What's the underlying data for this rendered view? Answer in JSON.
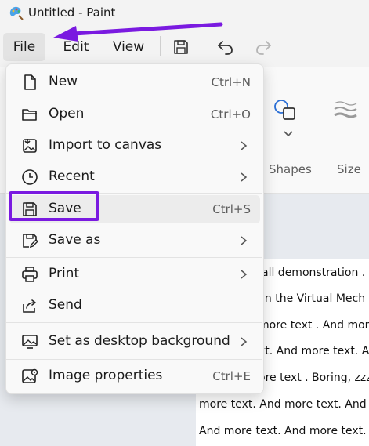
{
  "window": {
    "title": "Untitled - Paint"
  },
  "menubar": {
    "file": "File",
    "edit": "Edit",
    "view": "View"
  },
  "ribbon": {
    "shapes_label": "Shapes",
    "size_label": "Size"
  },
  "file_menu": {
    "items": [
      {
        "label": "New",
        "shortcut": "Ctrl+N",
        "icon": "new-file-icon"
      },
      {
        "label": "Open",
        "shortcut": "Ctrl+O",
        "icon": "folder-icon"
      },
      {
        "label": "Import to canvas",
        "shortcut": "",
        "icon": "import-image-icon",
        "submenu": true
      },
      {
        "label": "Recent",
        "shortcut": "",
        "icon": "clock-icon",
        "submenu": true
      },
      {
        "label": "Save",
        "shortcut": "Ctrl+S",
        "icon": "save-icon"
      },
      {
        "label": "Save as",
        "shortcut": "",
        "icon": "save-as-icon",
        "submenu": true
      },
      {
        "label": "Print",
        "shortcut": "",
        "icon": "printer-icon",
        "submenu": true
      },
      {
        "label": "Send",
        "shortcut": "",
        "icon": "share-icon"
      },
      {
        "label": "Set as desktop background",
        "shortcut": "",
        "icon": "desktop-background-icon",
        "submenu": true
      },
      {
        "label": "Image properties",
        "shortcut": "Ctrl+E",
        "icon": "image-properties-icon"
      }
    ]
  },
  "canvas_text": {
    "lines": [
      "all demonstration .",
      "in the Virtual Mech",
      "more text . And more t",
      "xt. And more text. A",
      "ore text . Boring, zzz",
      "more text. And more text. And",
      "And more text. And more text."
    ]
  },
  "annotation": {
    "accent_color": "#7a1ae0"
  }
}
